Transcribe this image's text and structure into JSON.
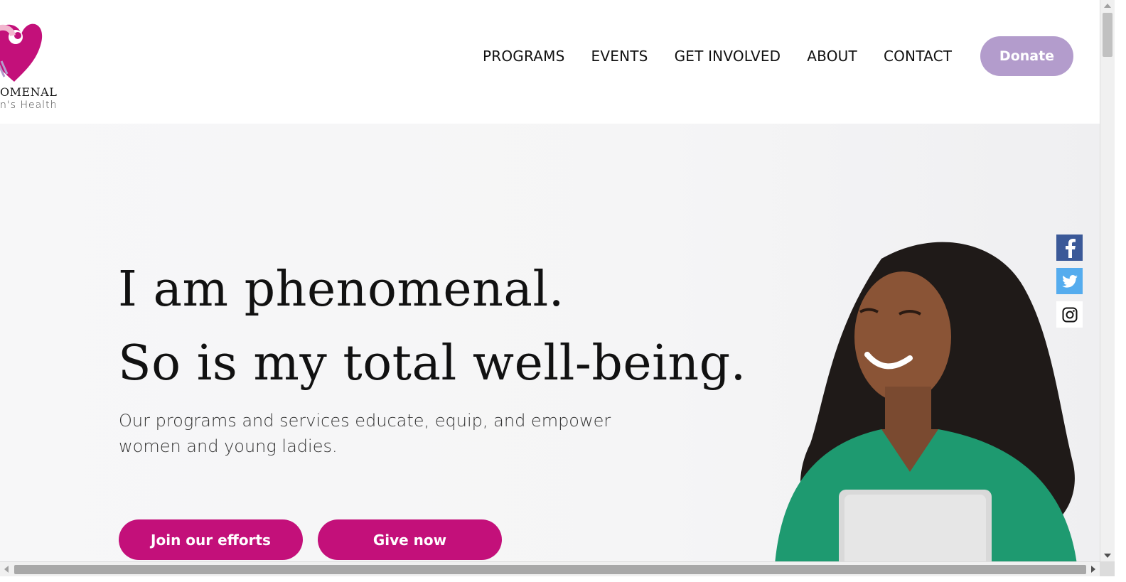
{
  "header": {
    "logo": {
      "line1": "OMENAL",
      "line2": "n's Health",
      "colors": {
        "magenta": "#c3107a",
        "pink": "#f2b6cf",
        "lavender": "#b39ccc"
      }
    },
    "nav": [
      {
        "label": "PROGRAMS"
      },
      {
        "label": "EVENTS"
      },
      {
        "label": "GET INVOLVED"
      },
      {
        "label": "ABOUT"
      },
      {
        "label": "CONTACT"
      }
    ],
    "donate_label": "Donate",
    "donate_color": "#b39ccc"
  },
  "hero": {
    "headline_line1": "I am phenomenal.",
    "headline_line2": "So is my total well-being.",
    "subtext": "Our programs and services educate, equip, and empower women and young ladies.",
    "cta_join": "Join our efforts",
    "cta_give": "Give now",
    "cta_color": "#c3107a"
  },
  "social": [
    {
      "icon": "facebook-icon",
      "color": "#3b5998"
    },
    {
      "icon": "twitter-icon",
      "color": "#55acee"
    },
    {
      "icon": "instagram-icon",
      "color": "#111111"
    }
  ]
}
